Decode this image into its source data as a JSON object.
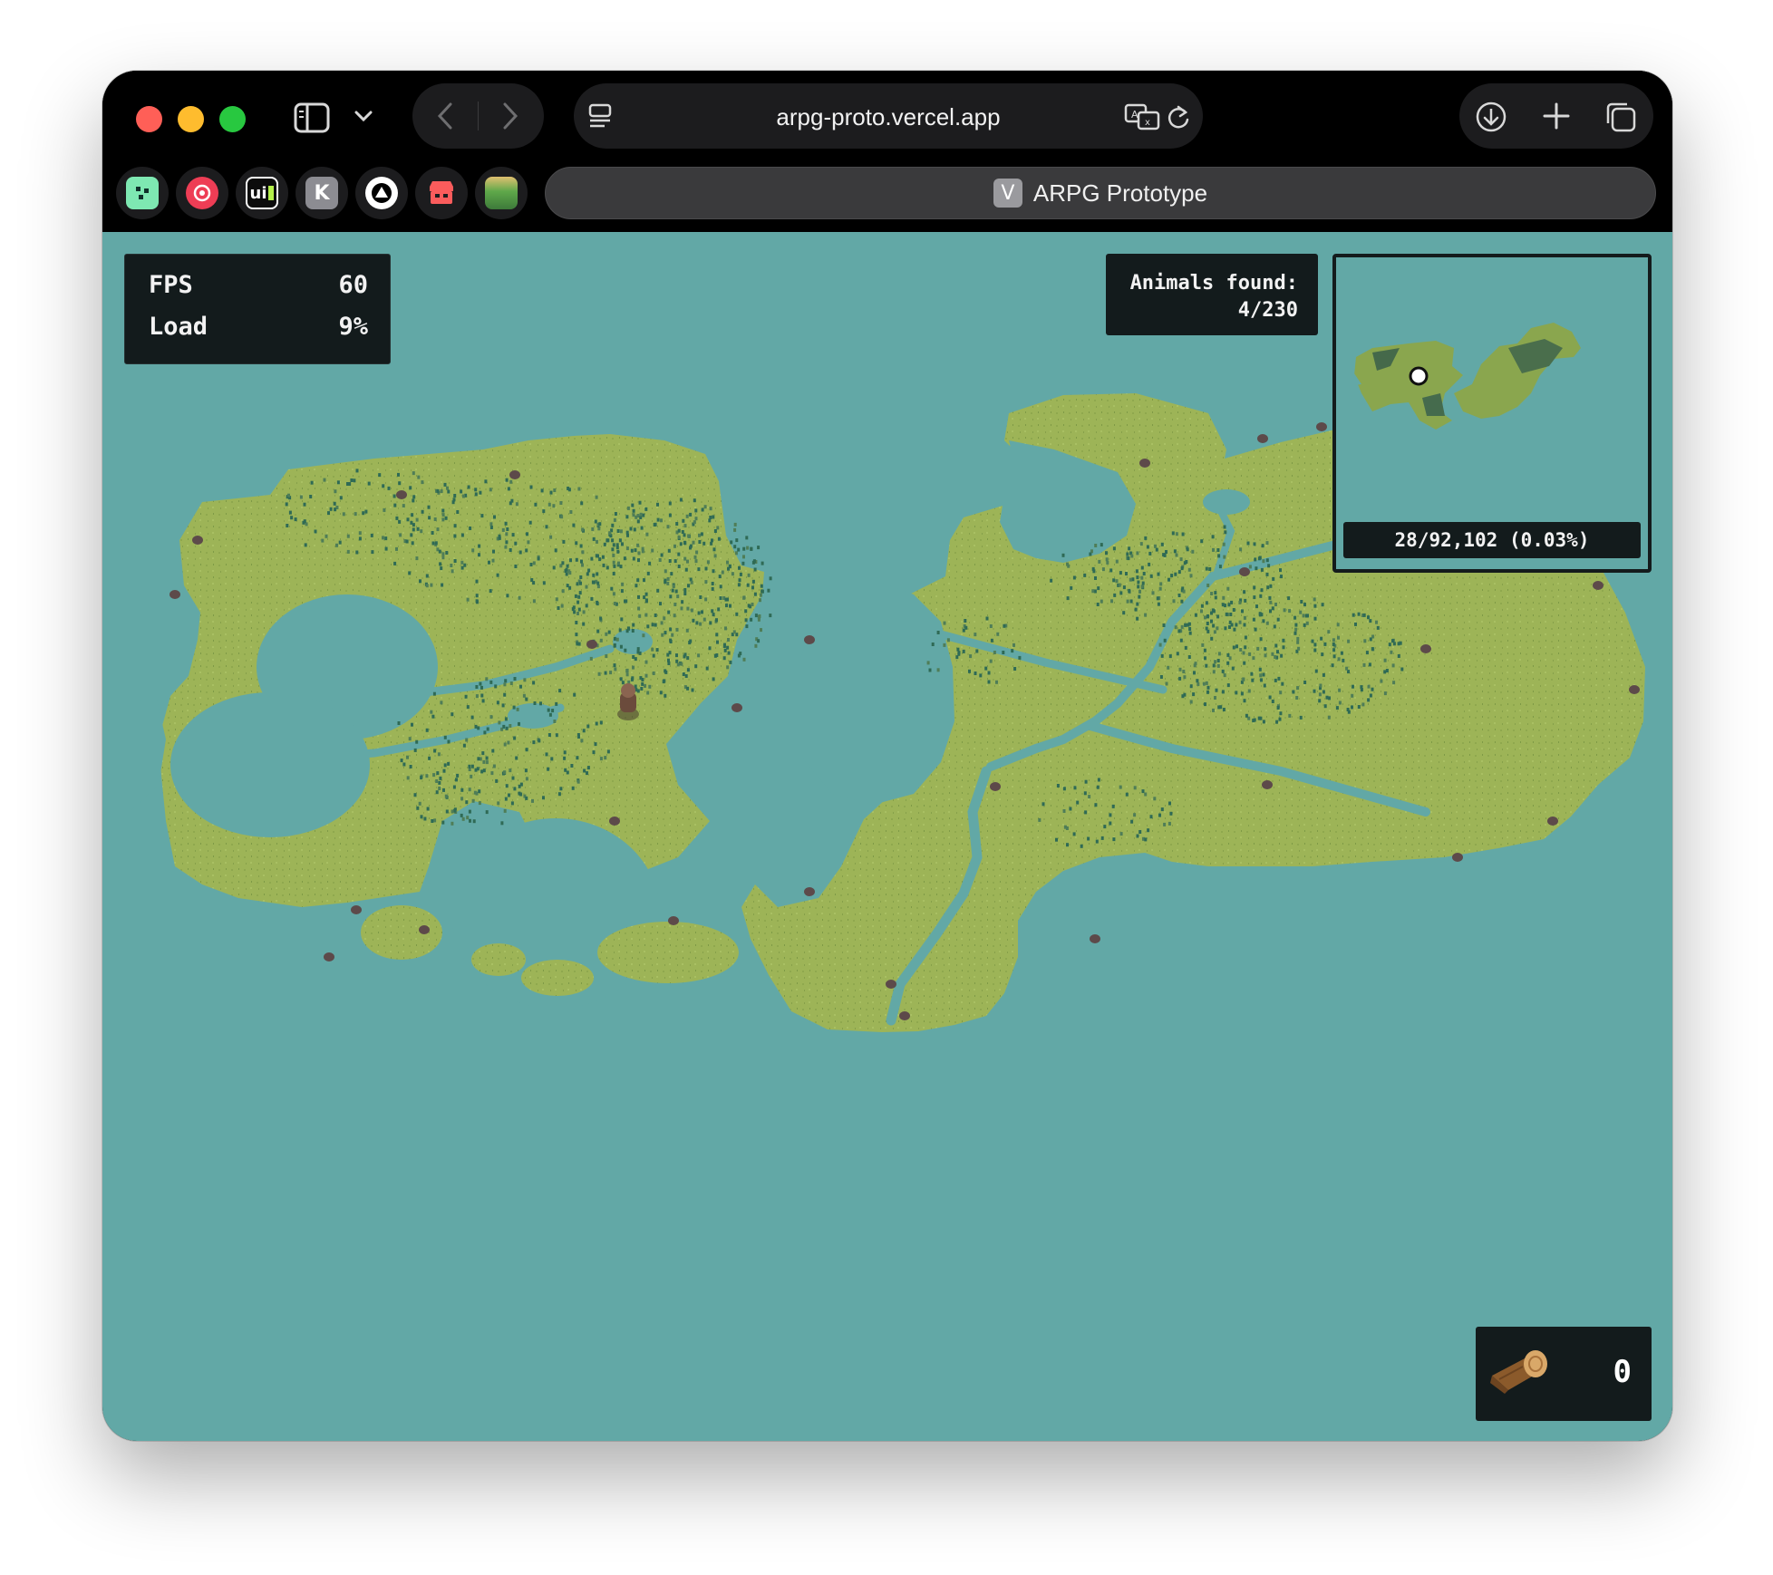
{
  "browser": {
    "url": "arpg-proto.vercel.app",
    "tab_title": "ARPG Prototype",
    "tab_favicon_letter": "V",
    "bookmarks": [
      {
        "icon": "grid-app-icon",
        "text": ""
      },
      {
        "icon": "target-app-icon",
        "text": ""
      },
      {
        "icon": "ui-app-icon",
        "text": "ui"
      },
      {
        "icon": "k-app-icon",
        "text": "K"
      },
      {
        "icon": "triangle-app-icon",
        "text": ""
      },
      {
        "icon": "itchio-app-icon",
        "text": ""
      },
      {
        "icon": "game-thumbnail-icon",
        "text": ""
      }
    ],
    "toolbar_icons": [
      "sidebar-toggle-icon",
      "chevron-down-icon",
      "back-icon",
      "forward-icon",
      "reader-icon",
      "translate-icon",
      "reload-icon",
      "download-icon",
      "new-tab-icon",
      "tab-overview-icon"
    ]
  },
  "hud": {
    "fps_label": "FPS",
    "fps_value": "60",
    "load_label": "Load",
    "load_value": "9%",
    "animals_label": "Animals found:",
    "animals_value": "4/230",
    "minimap_explored": "28/92,102 (0.03%)",
    "inventory_item": "wood-log-icon",
    "inventory_count": "0"
  },
  "colors": {
    "water": "#62a8a6",
    "grass": "#9db457",
    "hud_bg": "#131b1c",
    "tree": "#2f6a55"
  }
}
